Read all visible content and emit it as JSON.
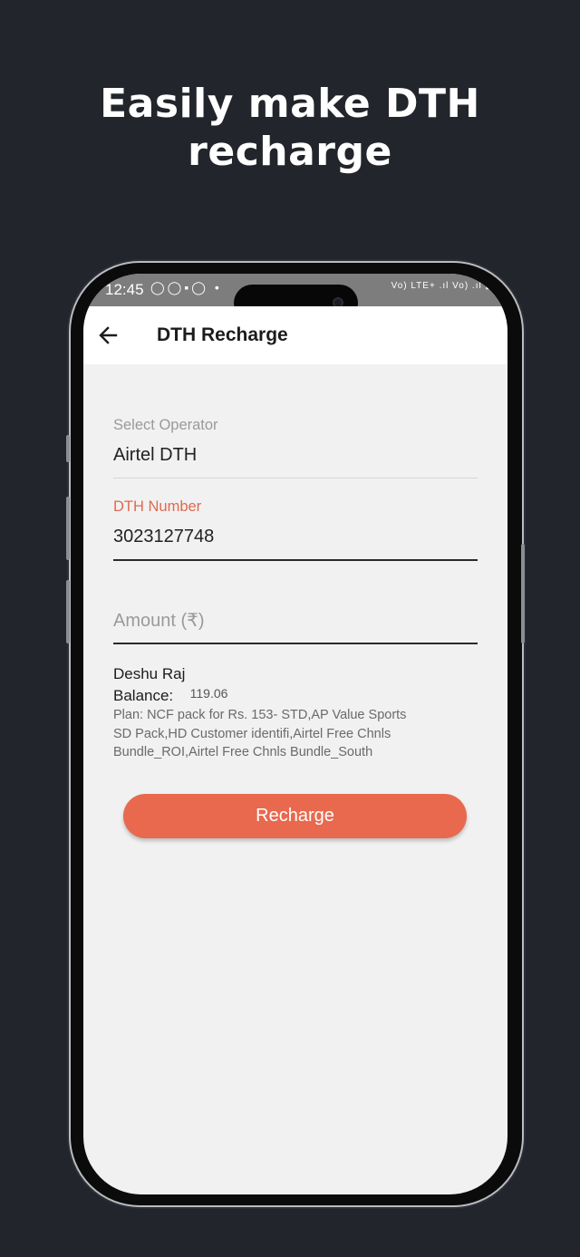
{
  "headline": {
    "line1": "Easily make DTH",
    "line2": "recharge"
  },
  "status_bar": {
    "time": "12:45",
    "icons": "◯◯▪◯ •",
    "network": "Vo) LTE+ .ıl Vo) .ıl ▮"
  },
  "app_bar": {
    "title": "DTH Recharge",
    "back_icon": "arrow-left-icon"
  },
  "form": {
    "operator_label": "Select Operator",
    "operator_value": "Airtel DTH",
    "dth_label": "DTH Number",
    "dth_value": "3023127748",
    "amount_placeholder": "Amount (₹)"
  },
  "customer": {
    "name": "Deshu Raj",
    "balance_label": "Balance:",
    "balance_value": "119.06",
    "plan": "Plan: NCF pack for Rs. 153- STD,AP Value Sports SD Pack,HD Customer identifi,Airtel Free Chnls Bundle_ROI,Airtel Free Chnls Bundle_South"
  },
  "recharge_button": "Recharge",
  "colors": {
    "background": "#22252b",
    "accent": "#e8694e",
    "screen": "#f1f1f1"
  }
}
